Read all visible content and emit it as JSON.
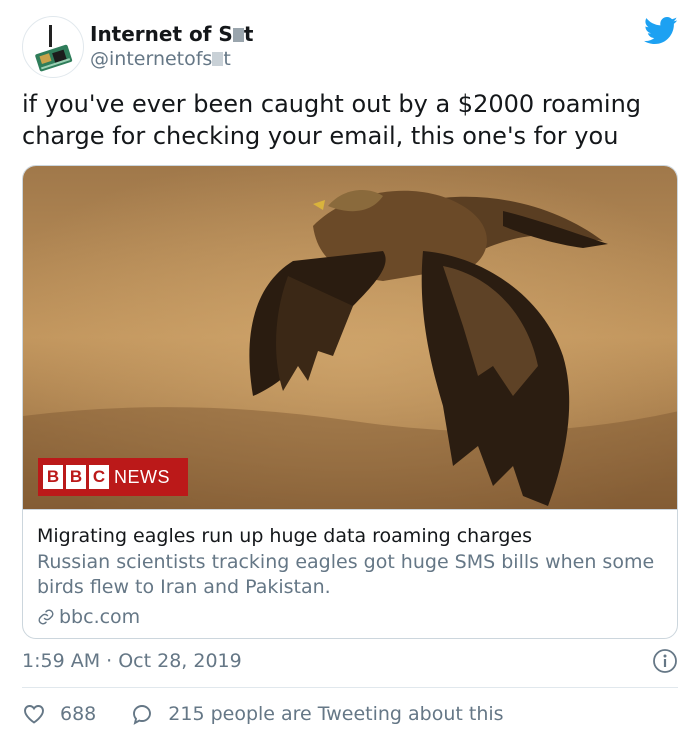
{
  "account": {
    "name_start": "Internet of S",
    "name_end": "t",
    "handle_start": "@internetofs",
    "handle_end": "t"
  },
  "tweet": {
    "text": "if you've ever been caught out by a $2000 roaming charge for checking your email, this one's for you",
    "timestamp": "1:59 AM · Oct 28, 2019"
  },
  "card": {
    "logo_letters": [
      "B",
      "B",
      "C"
    ],
    "logo_word": "NEWS",
    "title": "Migrating eagles run up huge data roaming charges",
    "description": "Russian scientists tracking eagles got huge SMS bills when some birds flew to Iran and Pakistan.",
    "domain": "bbc.com"
  },
  "actions": {
    "like_count": "688",
    "conversation_text": "215 people are Tweeting about this"
  },
  "colors": {
    "twitter_blue": "#1da1f2",
    "bbc_red": "#bb1919",
    "secondary_text": "#657786"
  }
}
